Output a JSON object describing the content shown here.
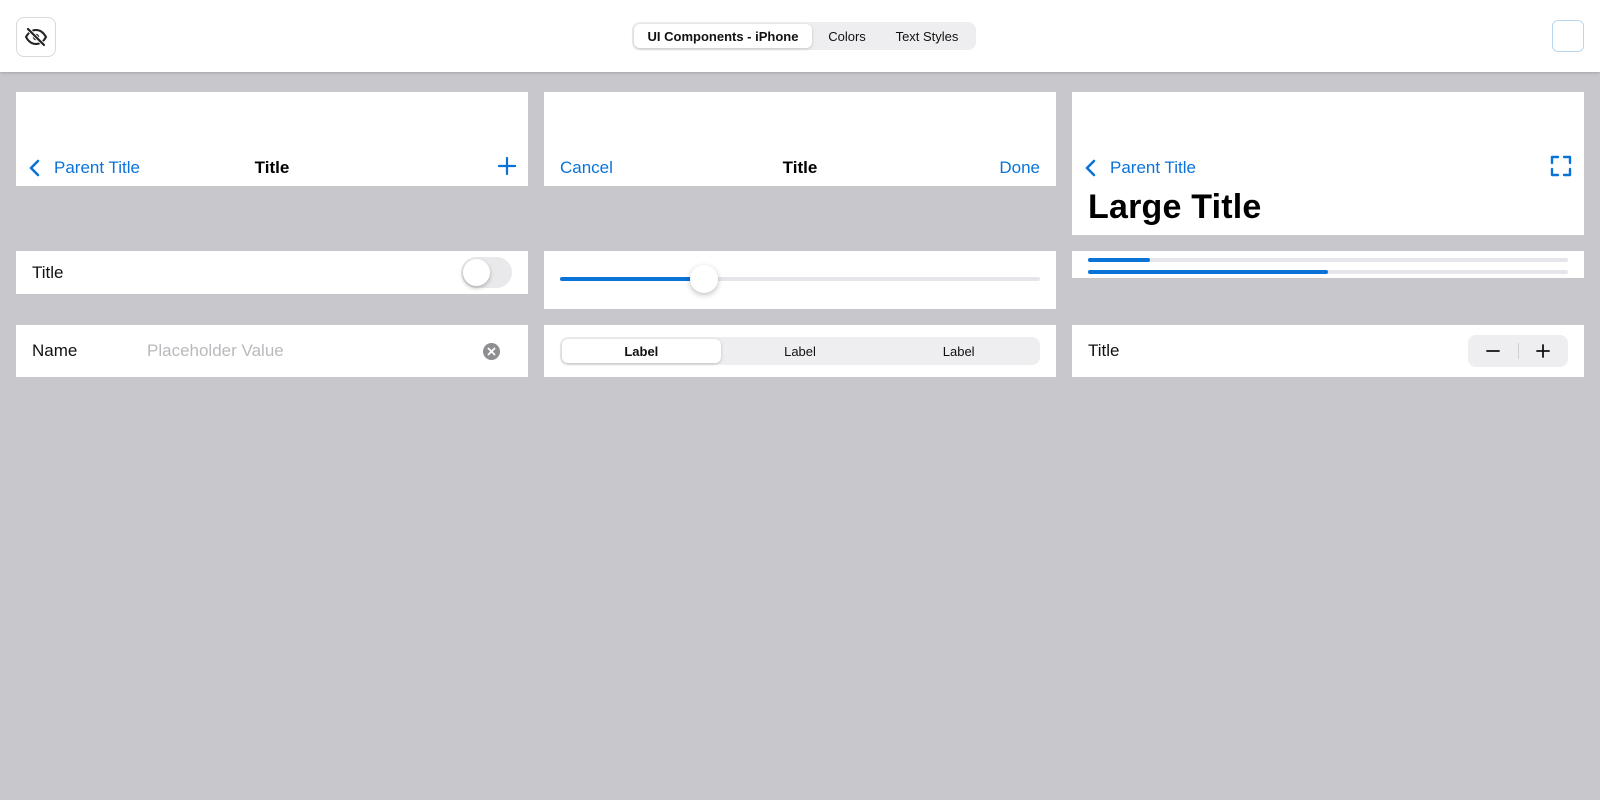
{
  "toolbar": {
    "visibility_icon": "eye-slash-icon",
    "tabs": [
      {
        "label": "UI Components - iPhone",
        "active": true
      },
      {
        "label": "Colors",
        "active": false
      },
      {
        "label": "Text Styles",
        "active": false
      }
    ]
  },
  "nav1": {
    "back_label": "Parent Title",
    "title": "Title",
    "right_icon": "plus-icon"
  },
  "nav2": {
    "left_label": "Cancel",
    "title": "Title",
    "right_label": "Done"
  },
  "nav3": {
    "back_label": "Parent Title",
    "large_title": "Large Title",
    "right_icon": "fullscreen-icon"
  },
  "toggle_row": {
    "label": "Title",
    "on": false
  },
  "slider": {
    "value": 0.3
  },
  "progress": {
    "value1": 0.13,
    "value2": 0.5
  },
  "input_row": {
    "label": "Name",
    "placeholder": "Placeholder Value"
  },
  "segmented": {
    "items": [
      "Label",
      "Label",
      "Label"
    ],
    "selected": 0
  },
  "stepper_row": {
    "label": "Title",
    "minus": "−",
    "plus": "+"
  },
  "colors": {
    "accent": "#0a73d8",
    "background": "#c8c7cc"
  }
}
